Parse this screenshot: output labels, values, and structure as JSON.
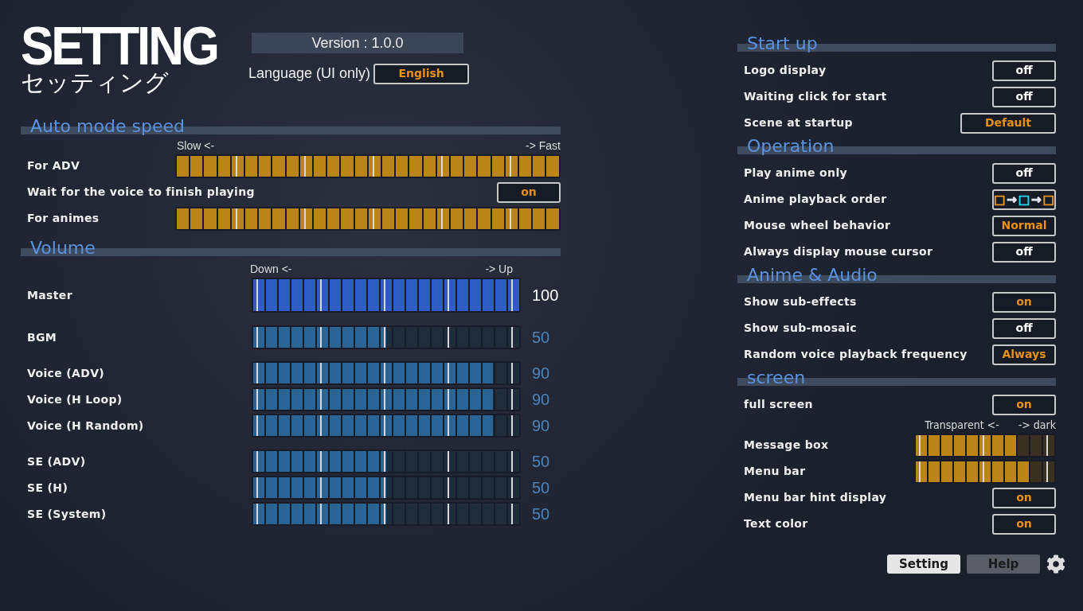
{
  "logo": {
    "title": "SETTING",
    "subtitle": "セッティング"
  },
  "version": "Version : 1.0.0",
  "language": {
    "label": "Language (UI only)",
    "value": "English"
  },
  "auto_mode": {
    "title": "Auto mode speed",
    "scale": {
      "low": "Slow <-",
      "high": "-> Fast"
    },
    "rows": [
      {
        "kind": "slider",
        "label": "For ADV",
        "level": 1
      },
      {
        "kind": "toggle",
        "label": "Wait for the voice to finish playing",
        "value": "on",
        "active": true
      },
      {
        "kind": "slider",
        "label": "For animes",
        "level": 1
      }
    ]
  },
  "volume": {
    "title": "Volume",
    "scale": {
      "low": "Down <-",
      "high": "-> Up"
    },
    "groups": [
      [
        {
          "label": "Master",
          "level": 1,
          "reading": "100",
          "selected": true
        }
      ],
      [
        {
          "label": "BGM",
          "level": 0.5,
          "reading": "50",
          "selected": false
        }
      ],
      [
        {
          "label": "Voice (ADV)",
          "level": 0.9,
          "reading": "90",
          "selected": false
        },
        {
          "label": "Voice (H Loop)",
          "level": 0.9,
          "reading": "90",
          "selected": false
        },
        {
          "label": "Voice (H Random)",
          "level": 0.9,
          "reading": "90",
          "selected": false
        }
      ],
      [
        {
          "label": "SE (ADV)",
          "level": 0.5,
          "reading": "50",
          "selected": false
        },
        {
          "label": "SE (H)",
          "level": 0.5,
          "reading": "50",
          "selected": false
        },
        {
          "label": "SE (System)",
          "level": 0.5,
          "reading": "50",
          "selected": false
        }
      ]
    ]
  },
  "right_sections": [
    {
      "title": "Start up",
      "rows": [
        {
          "kind": "toggle",
          "label": "Logo display",
          "value": "off",
          "active": false
        },
        {
          "kind": "toggle",
          "label": "Waiting click for start",
          "value": "off",
          "active": false
        },
        {
          "kind": "wide",
          "label": "Scene at startup",
          "value": "Default",
          "active": true
        }
      ]
    },
    {
      "title": "Operation",
      "rows": [
        {
          "kind": "toggle",
          "label": "Play anime only",
          "value": "off",
          "active": false
        },
        {
          "kind": "sequence",
          "label": "Anime playback order",
          "parts": [
            {
              "text": "□",
              "color": "#e8901a"
            },
            {
              "text": "→",
              "color": "#e5e7eb"
            },
            {
              "text": "□",
              "color": "#22d3ee"
            },
            {
              "text": "→",
              "color": "#e5e7eb"
            },
            {
              "text": "□",
              "color": "#e8901a"
            }
          ]
        },
        {
          "kind": "toggle",
          "label": "Mouse wheel behavior",
          "value": "Normal",
          "active": true
        },
        {
          "kind": "toggle",
          "label": "Always display mouse cursor",
          "value": "off",
          "active": false
        }
      ]
    },
    {
      "title": "Anime & Audio",
      "rows": [
        {
          "kind": "toggle",
          "label": "Show sub-effects",
          "value": "on",
          "active": true
        },
        {
          "kind": "toggle",
          "label": "Show sub-mosaic",
          "value": "off",
          "active": false
        },
        {
          "kind": "toggle",
          "label": "Random voice playback frequency",
          "value": "Always",
          "active": true
        }
      ]
    },
    {
      "title": "screen",
      "rows": [
        {
          "kind": "toggle",
          "label": "full screen",
          "value": "on",
          "active": true
        },
        {
          "kind": "scale",
          "low": "Transparent <-",
          "high": "-> dark"
        },
        {
          "kind": "slider",
          "label": "Message box",
          "level": 0.73
        },
        {
          "kind": "slider",
          "label": "Menu bar",
          "level": 0.82
        },
        {
          "kind": "toggle",
          "label": "Menu bar hint display",
          "value": "on",
          "active": true
        },
        {
          "kind": "toggle",
          "label": "Text color",
          "value": "on",
          "active": true
        }
      ]
    }
  ],
  "footer": {
    "tabs": [
      {
        "label": "Setting",
        "selected": true
      },
      {
        "label": "Help",
        "selected": false
      }
    ]
  }
}
